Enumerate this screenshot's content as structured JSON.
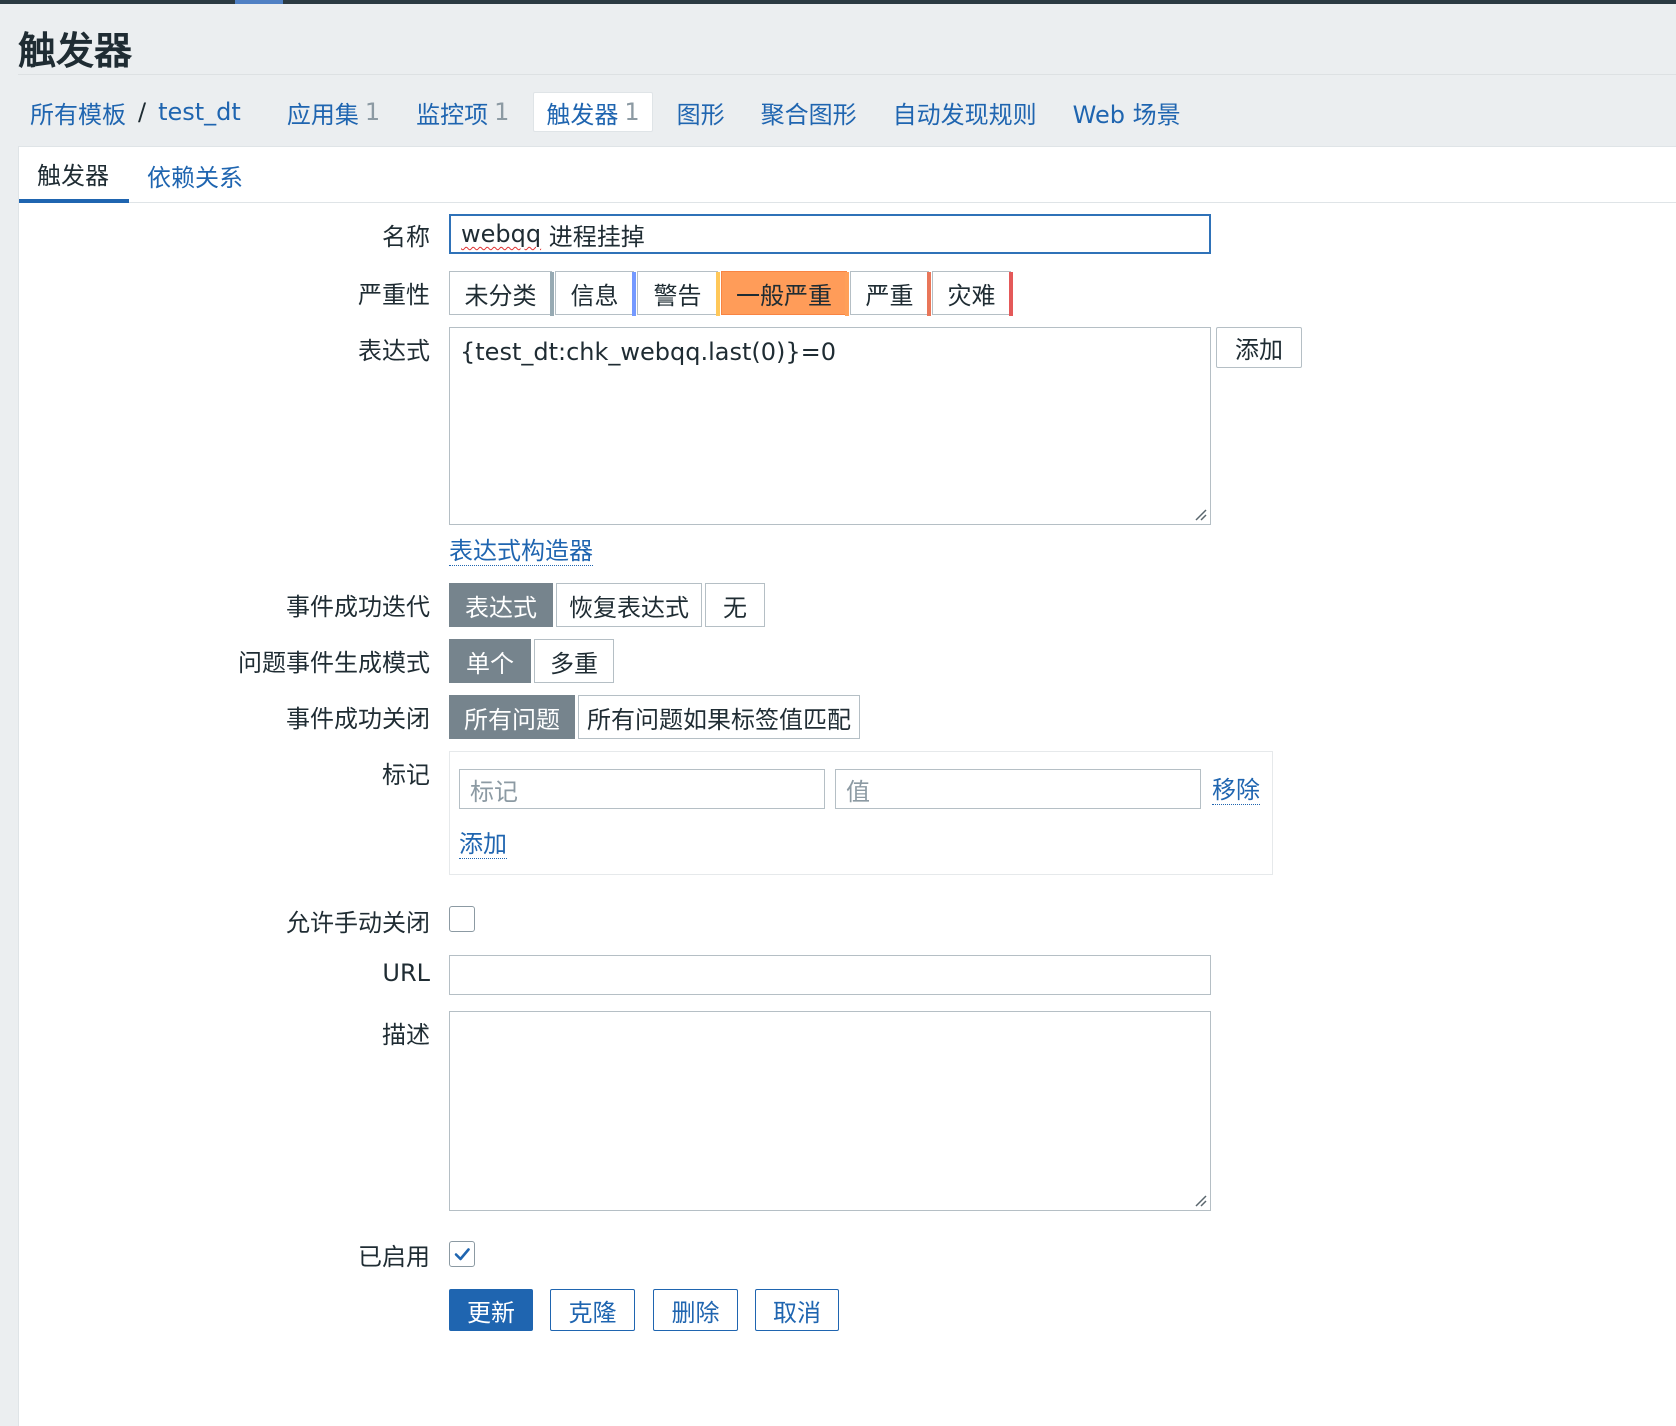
{
  "page": {
    "title": "触发器"
  },
  "breadcrumbs": {
    "all_templates": "所有模板",
    "separator": "/",
    "template_name": "test_dt",
    "items": [
      {
        "label": "应用集",
        "count": "1"
      },
      {
        "label": "监控项",
        "count": "1"
      },
      {
        "label": "触发器",
        "count": "1"
      },
      {
        "label": "图形",
        "count": ""
      },
      {
        "label": "聚合图形",
        "count": ""
      },
      {
        "label": "自动发现规则",
        "count": ""
      },
      {
        "label": "Web 场景",
        "count": ""
      }
    ]
  },
  "tabs": [
    {
      "label": "触发器"
    },
    {
      "label": "依赖关系"
    }
  ],
  "form": {
    "name": {
      "label": "名称",
      "value_word": "webqq",
      "value_rest": " 进程挂掉"
    },
    "severity": {
      "label": "严重性",
      "options": [
        {
          "label": "未分类",
          "color": "#97aab3"
        },
        {
          "label": "信息",
          "color": "#7499ff"
        },
        {
          "label": "警告",
          "color": "#ffc859"
        },
        {
          "label": "一般严重",
          "color": "#ffa059"
        },
        {
          "label": "严重",
          "color": "#e97659"
        },
        {
          "label": "灾难",
          "color": "#e45959"
        }
      ],
      "selected": "一般严重"
    },
    "expression": {
      "label": "表达式",
      "value": "{test_dt:chk_webqq.last(0)}=0",
      "add_button": "添加",
      "constructor_link": "表达式构造器"
    },
    "ok_event_generation": {
      "label": "事件成功迭代",
      "options": [
        "表达式",
        "恢复表达式",
        "无"
      ],
      "selected": "表达式"
    },
    "problem_mode": {
      "label": "问题事件生成模式",
      "options": [
        "单个",
        "多重"
      ],
      "selected": "单个"
    },
    "ok_event_closes": {
      "label": "事件成功关闭",
      "options": [
        "所有问题",
        "所有问题如果标签值匹配"
      ],
      "selected": "所有问题"
    },
    "tags": {
      "label": "标记",
      "tag_placeholder": "标记",
      "value_placeholder": "值",
      "remove_link": "移除",
      "add_link": "添加"
    },
    "manual_close": {
      "label": "允许手动关闭",
      "checked": false
    },
    "url": {
      "label": "URL",
      "value": ""
    },
    "description": {
      "label": "描述",
      "value": ""
    },
    "enabled": {
      "label": "已启用",
      "checked": true
    }
  },
  "actions": {
    "update": "更新",
    "clone": "克隆",
    "delete": "删除",
    "cancel": "取消"
  },
  "colors": {
    "link": "#1f65b0",
    "selected_segment": "#76848d",
    "severity_active_bg": "#ff9c59"
  }
}
